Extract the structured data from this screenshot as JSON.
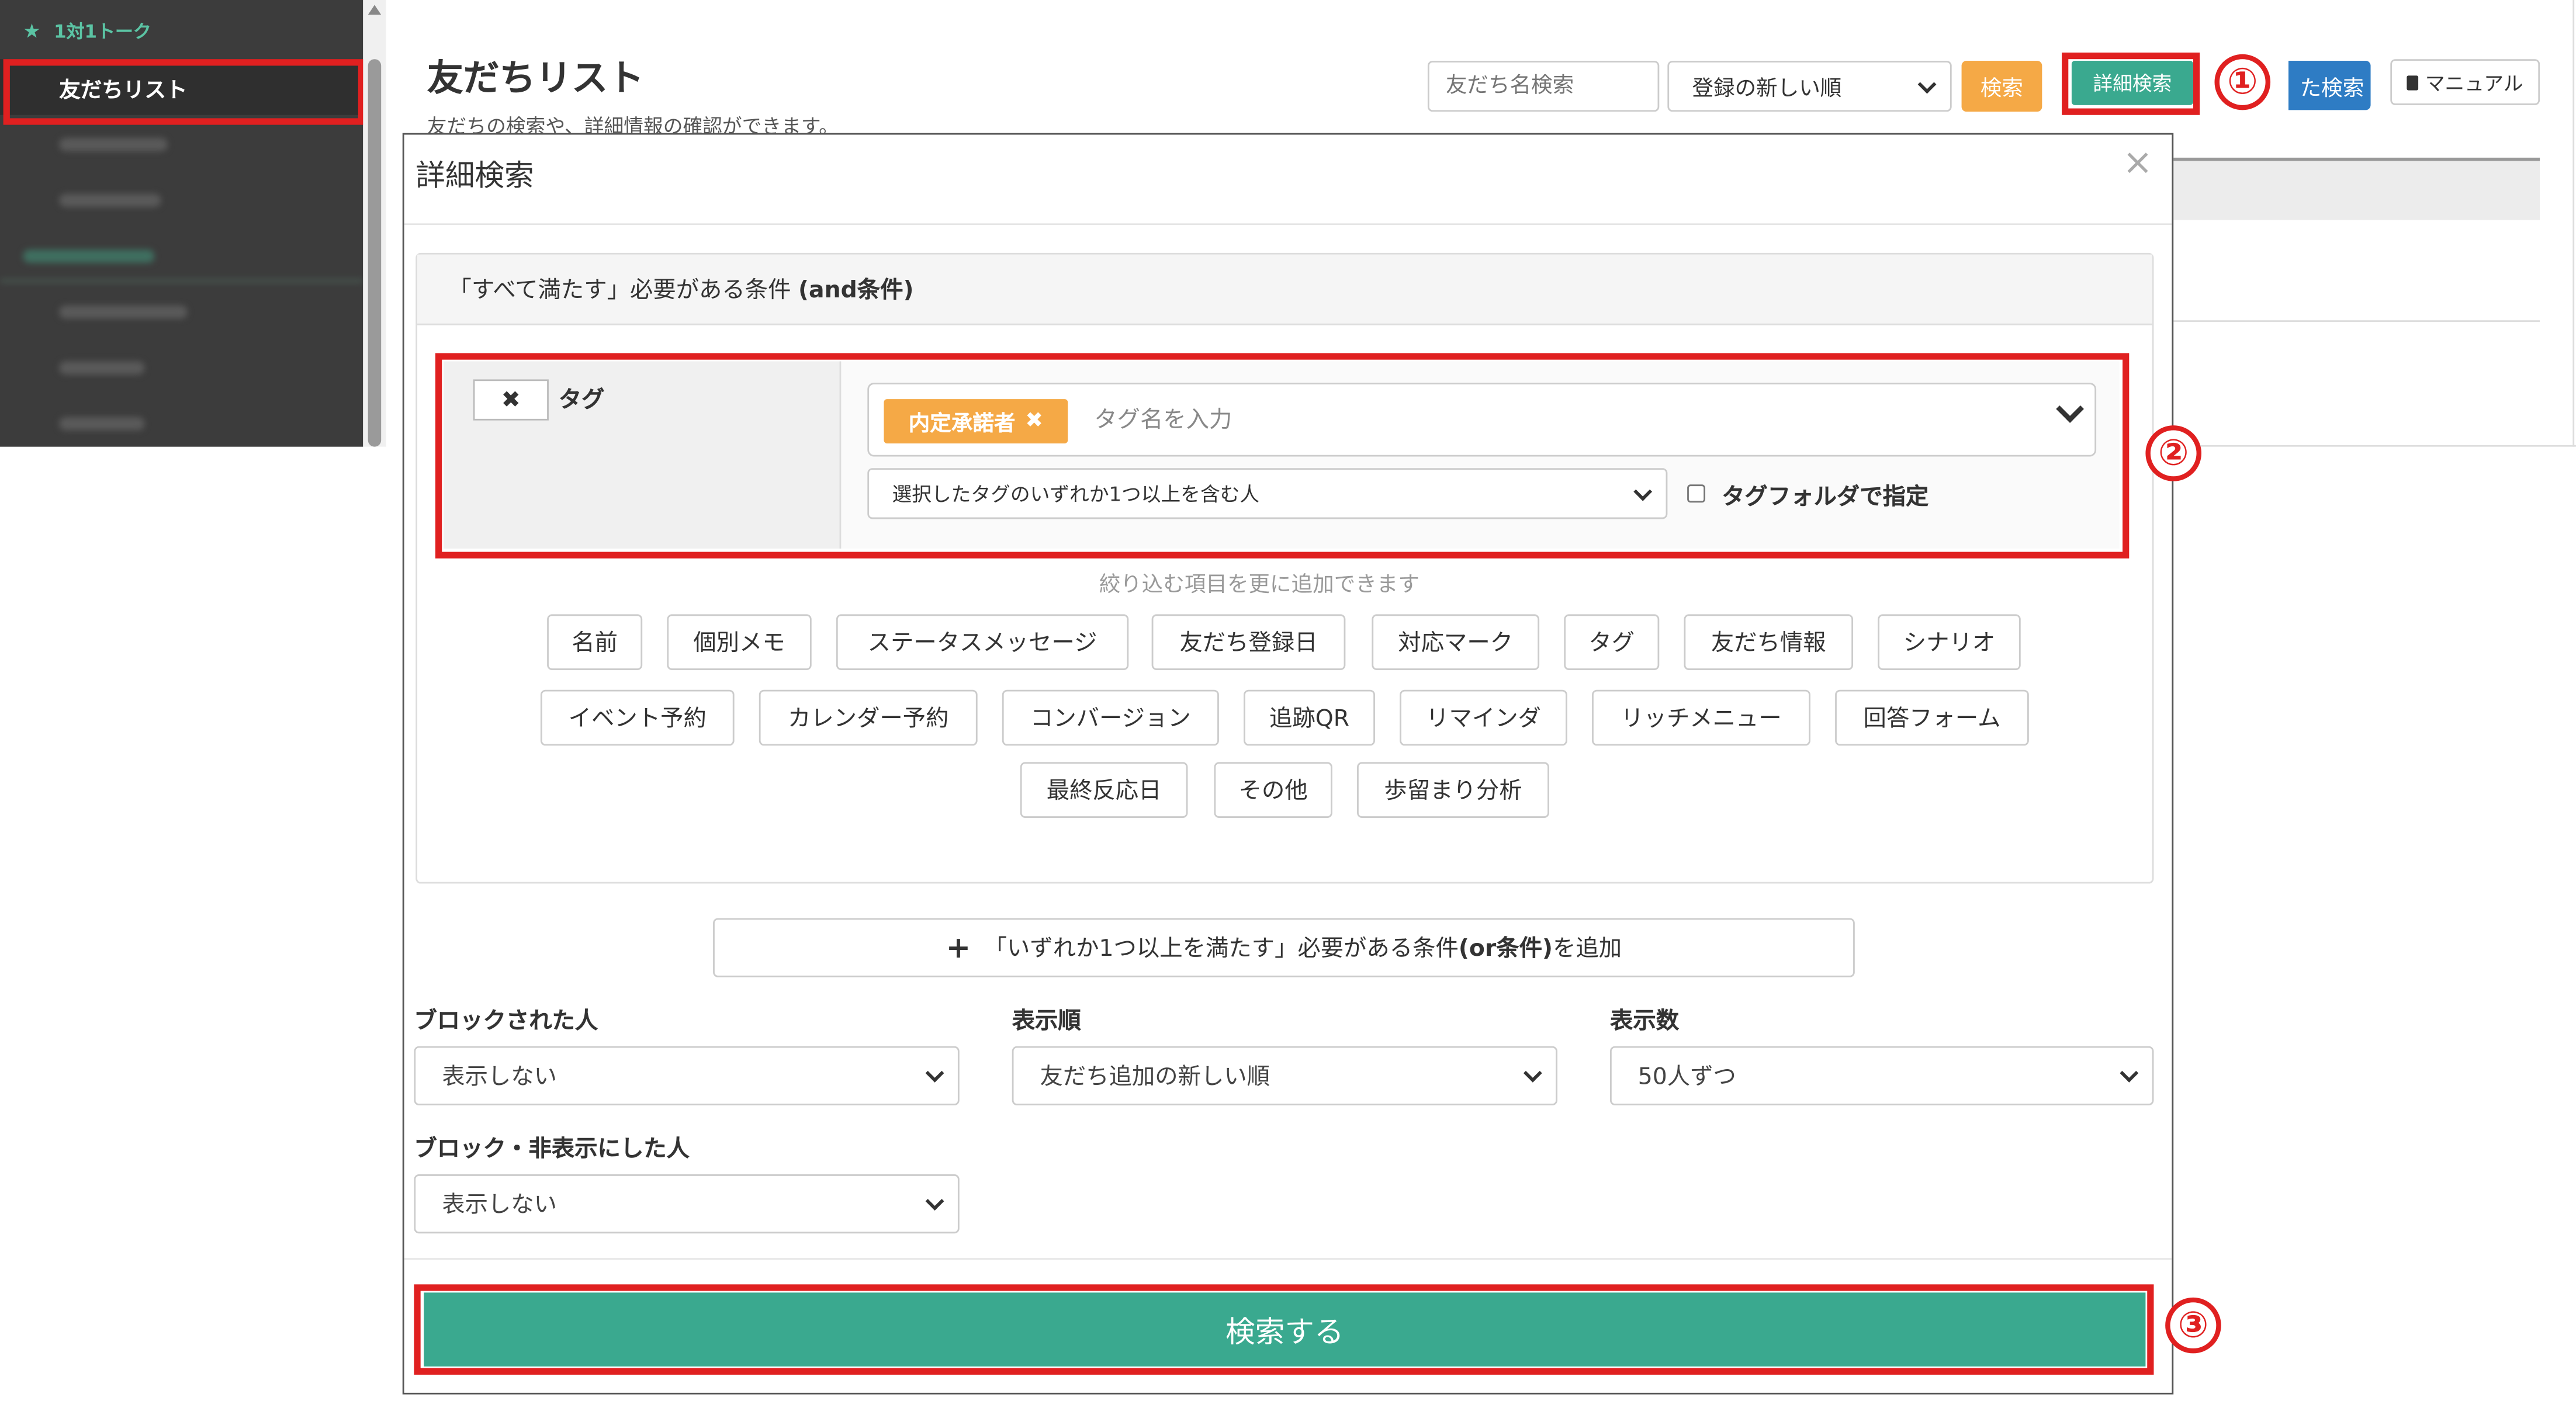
{
  "sidebar": {
    "section_label": "1対1トーク",
    "active_item": "友だちリスト"
  },
  "header": {
    "title": "友だちリスト",
    "description": "友だちの検索や、詳細情報の確認ができます。",
    "search_placeholder": "友だち名検索",
    "sort_selected": "登録の新しい順",
    "search_button": "検索",
    "detail_search_button": "詳細検索",
    "saved_search_button": "た検索",
    "manual_button": "マニュアル"
  },
  "annotations": {
    "step1": "①",
    "step2": "②",
    "step3": "③"
  },
  "modal": {
    "title": "詳細検索",
    "close": "×",
    "and_condition_prefix": "「すべて満たす」必要がある条件 ",
    "and_condition_bold": "(and条件)",
    "tag_label": "タグ",
    "tag_remove": "✖",
    "selected_tag": "内定承諾者",
    "tag_input_placeholder": "タグ名を入力",
    "tag_match_mode": "選択したタグのいずれか1つ以上を含む人",
    "tag_folder_label": "タグフォルダで指定",
    "more_hint": "絞り込む項目を更に追加できます",
    "filter_buttons": [
      "名前",
      "個別メモ",
      "ステータスメッセージ",
      "友だち登録日",
      "対応マーク",
      "タグ",
      "友だち情報",
      "シナリオ",
      "イベント予約",
      "カレンダー予約",
      "コンバージョン",
      "追跡QR",
      "リマインダ",
      "リッチメニュー",
      "回答フォーム",
      "最終反応日",
      "その他",
      "歩留まり分析"
    ],
    "or_condition_prefix": "「いずれか1つ以上を満たす」必要がある条件",
    "or_condition_bold": "(or条件)",
    "or_condition_suffix": "を追加",
    "blocked_label": "ブロックされた人",
    "blocked_value": "表示しない",
    "order_label": "表示順",
    "order_value": "友だち追加の新しい順",
    "count_label": "表示数",
    "count_value": "50人ずつ",
    "hidden_label": "ブロック・非表示にした人",
    "hidden_value": "表示しない",
    "submit": "検索する"
  }
}
